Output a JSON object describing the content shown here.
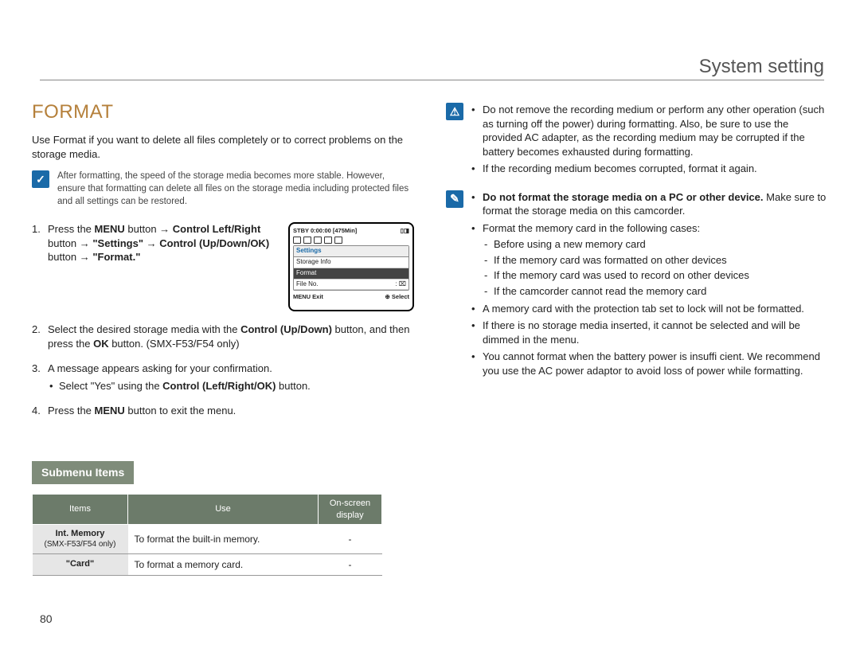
{
  "header": {
    "title": "System setting"
  },
  "section": {
    "heading": "FORMAT"
  },
  "intro": "Use Format if you want to delete all files completely or to correct problems on the storage media.",
  "note1": "After formatting, the speed of the storage media becomes more stable. However, ensure that formatting can delete all files on the storage media including protected files and all settings can be restored.",
  "steps": {
    "s1": {
      "a": "Press the ",
      "b": "MENU",
      "c": " button → ",
      "d": "Control Left/Right",
      "e": " button → ",
      "f": "\"Settings\"",
      "g": " → ",
      "h": "Control (Up/Down/OK)",
      "i": " button → ",
      "j": "\"Format.\""
    },
    "s2": {
      "a": "Select the desired storage media with the ",
      "b": "Control (Up/Down)",
      "c": " button, and then press the ",
      "d": "OK",
      "e": " button. (SMX-F53/F54 only)"
    },
    "s3": {
      "a": "A message appears asking for your confirmation.",
      "sub_a": "Select \"Yes\" using the ",
      "sub_b": "Control (Left/Right/OK)",
      "sub_c": " button."
    },
    "s4": {
      "a": "Press the ",
      "b": "MENU",
      "c": " button to exit the menu."
    }
  },
  "screen": {
    "top_left": "STBY 0:00:00 [475Min]",
    "tab": "Settings",
    "row1": "Storage Info",
    "row2": "Format",
    "row3": "File No.",
    "foot_left": "MENU Exit",
    "foot_right": "Select"
  },
  "submenu": {
    "label": "Submenu Items",
    "headers": {
      "items": "Items",
      "use": "Use",
      "display": "On-screen display"
    },
    "rows": [
      {
        "item_line1": "Int. Memory",
        "item_line2": "(SMX-F53/F54 only)",
        "use": "To format the built-in memory.",
        "disp": "-"
      },
      {
        "item_line1": "\"Card\"",
        "item_line2": "",
        "use": "To format a memory card.",
        "disp": "-"
      }
    ]
  },
  "right": {
    "warn": {
      "b1": "Do not remove the recording medium or perform any other operation (such as turning off the power) during formatting. Also, be sure to use the provided AC adapter, as the recording medium may be corrupted if the battery becomes exhausted during formatting.",
      "b2": "If the recording medium becomes corrupted, format it again."
    },
    "note": {
      "b1_bold": "Do not format the storage media on a PC or other device.",
      "b1_rest": "Make sure to format the storage media on this camcorder.",
      "b2": "Format the memory card in the following cases:",
      "b2_subs": [
        "Before using a new memory card",
        "If the memory card was formatted on other devices",
        "If the memory card was used to record on other devices",
        "If the camcorder cannot read the memory card"
      ],
      "b3": "A memory card with the protection tab set to lock will not be formatted.",
      "b4": "If there is no storage media inserted, it cannot be selected and will be dimmed in the menu.",
      "b5": "You cannot format when the battery power is insuffi cient. We recommend you use the AC power adaptor to avoid loss of power while formatting."
    }
  },
  "page_number": "80"
}
